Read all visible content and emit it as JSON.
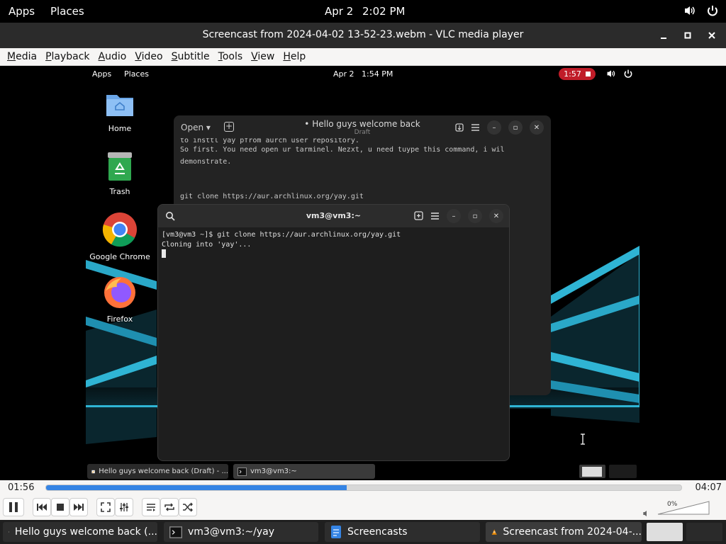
{
  "host_topbar": {
    "apps": "Apps",
    "places": "Places",
    "date": "Apr 2",
    "time": "2:02 PM"
  },
  "window": {
    "title": "Screencast from 2024-04-02 13-52-23.webm - VLC media player"
  },
  "menu": [
    {
      "label": "Media",
      "access": "M",
      "rest": "edia"
    },
    {
      "label": "Playback",
      "access": "P",
      "rest": "layback"
    },
    {
      "label": "Audio",
      "access": "A",
      "rest": "udio"
    },
    {
      "label": "Video",
      "access": "V",
      "rest": "ideo"
    },
    {
      "label": "Subtitle",
      "access": "S",
      "rest": "ubtitle"
    },
    {
      "label": "Tools",
      "access": "T",
      "rest": "ools"
    },
    {
      "label": "View",
      "access": "V",
      "rest": "iew"
    },
    {
      "label": "Help",
      "access": "H",
      "rest": "elp"
    }
  ],
  "guest": {
    "topbar": {
      "apps": "Apps",
      "places": "Places",
      "date": "Apr 2",
      "time": "1:54 PM",
      "rec_time": "1:57"
    },
    "desktop_icons": {
      "home": "Home",
      "trash": "Trash",
      "chrome": "Google Chrome",
      "firefox": "Firefox"
    },
    "editor": {
      "open": "Open",
      "title": "Hello guys welcome back",
      "subtitle": "Draft",
      "line0": "to insttl yay pfrom aurch user repository.",
      "line1": "So first. You need open ur tarminel. Nezxt, u need tuype this command, i wil",
      "line2": "demonstrate.",
      "line3": "git clone https://aur.archlinux.org/yay.git"
    },
    "terminal": {
      "title": "vm3@vm3:~",
      "line1": "[vm3@vm3 ~]$ git clone https://aur.archlinux.org/yay.git",
      "line2": "Cloning into 'yay'..."
    },
    "taskbar": {
      "editor": "Hello guys welcome back (Draft) - ...",
      "terminal": "vm3@vm3:~"
    }
  },
  "player": {
    "elapsed": "01:56",
    "total": "04:07",
    "progress": 0.473,
    "volume": "0%"
  },
  "host_taskbar": {
    "item1": "Hello guys welcome back (...",
    "item2": "vm3@vm3:~/yay",
    "item3": "Screencasts",
    "item4": "Screencast from 2024-04-..."
  },
  "colors": {
    "accent": "#3584e4",
    "record": "#c01c28"
  }
}
